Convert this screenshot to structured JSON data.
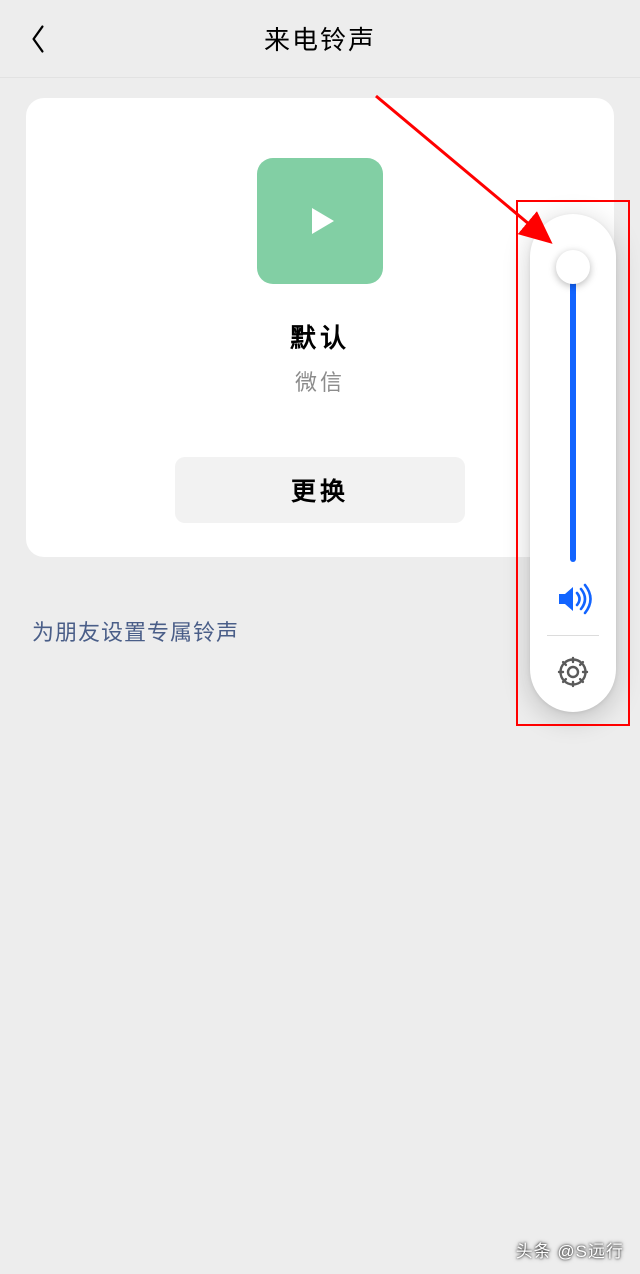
{
  "header": {
    "title": "来电铃声"
  },
  "card": {
    "ringtone_name": "默认",
    "ringtone_source": "微信",
    "change_label": "更换"
  },
  "friend_link": "为朋友设置专属铃声",
  "volume_panel": {
    "slider_value": 100,
    "speaker_icon": "speaker-loud",
    "settings_icon": "gear"
  },
  "watermark": "头条 @S远行",
  "colors": {
    "accent_blue": "#1264ff",
    "play_green": "#82cfa4",
    "annotation_red": "#ff0000"
  }
}
